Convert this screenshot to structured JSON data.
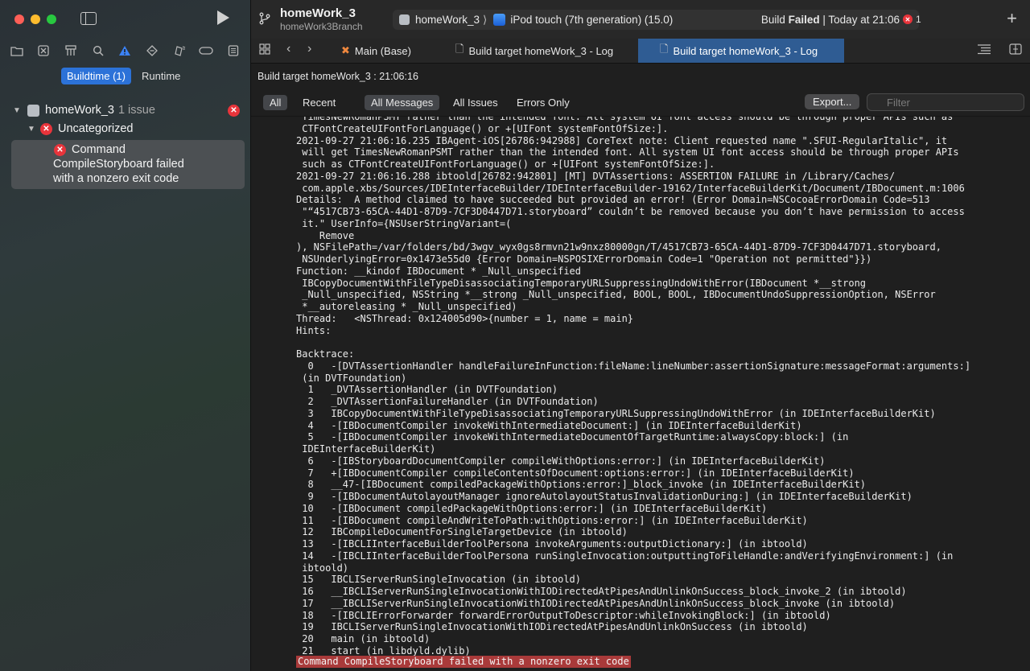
{
  "sidebar": {
    "nav_icons": [
      "folder-icon",
      "source-control-icon",
      "symbol-icon",
      "search-icon",
      "warning-icon",
      "breakpoint-icon",
      "debug-icon",
      "tag-icon",
      "report-icon"
    ],
    "build_tabs": {
      "buildtime": "Buildtime (1)",
      "runtime": "Runtime"
    },
    "project": {
      "name": "homeWork_3",
      "issue_count": "1 issue"
    },
    "group": {
      "label": "Uncategorized"
    },
    "issue": {
      "text_line1": "Command",
      "text_line2": "CompileStoryboard failed",
      "text_line3": "with a nonzero exit code"
    }
  },
  "toolbar": {
    "project_title": "homeWork_3",
    "branch": "homeWork3Branch",
    "scheme": "homeWork_3",
    "destination": "iPod touch (7th generation) (15.0)",
    "status_prefix": "Build ",
    "status_bold": "Failed",
    "status_suffix": " | Today at 21:06",
    "error_count": "1"
  },
  "tabs": [
    {
      "label": "Main (Base)",
      "icon": "swift-file-icon"
    },
    {
      "label": "Build target homeWork_3 - Log",
      "icon": "document-icon"
    },
    {
      "label": "Build target homeWork_3 - Log",
      "icon": "document-icon",
      "active": true
    }
  ],
  "log_header": {
    "title": "Build target homeWork_3 : 21:06:16"
  },
  "filters": {
    "all": "All",
    "recent": "Recent",
    "all_messages": "All Messages",
    "all_issues": "All Issues",
    "errors_only": "Errors Only",
    "export": "Export...",
    "filter_placeholder": "Filter"
  },
  "log_text": " TimesNewRomanPSMT rather than the intended font. All system UI font access should be through proper APIs such as\n CTFontCreateUIFontForLanguage() or +[UIFont systemFontOfSize:].\n2021-09-27 21:06:16.235 IBAgent-iOS[26786:942988] CoreText note: Client requested name \".SFUI-RegularItalic\", it\n will get TimesNewRomanPSMT rather than the intended font. All system UI font access should be through proper APIs\n such as CTFontCreateUIFontForLanguage() or +[UIFont systemFontOfSize:].\n2021-09-27 21:06:16.288 ibtoold[26782:942801] [MT] DVTAssertions: ASSERTION FAILURE in /Library/Caches/\n com.apple.xbs/Sources/IDEInterfaceBuilder/IDEInterfaceBuilder-19162/InterfaceBuilderKit/Document/IBDocument.m:1006\nDetails:  A method claimed to have succeeded but provided an error! (Error Domain=NSCocoaErrorDomain Code=513\n \"“4517CB73-65CA-44D1-87D9-7CF3D0447D71.storyboard” couldn’t be removed because you don’t have permission to access\n it.\" UserInfo={NSUserStringVariant=(\n    Remove\n), NSFilePath=/var/folders/bd/3wgv_wyx0gs8rmvn21w9nxz80000gn/T/4517CB73-65CA-44D1-87D9-7CF3D0447D71.storyboard,\n NSUnderlyingError=0x1473e55d0 {Error Domain=NSPOSIXErrorDomain Code=1 \"Operation not permitted\"}})\nFunction: __kindof IBDocument * _Null_unspecified\n IBCopyDocumentWithFileTypeDisassociatingTemporaryURLSuppressingUndoWithError(IBDocument *__strong\n _Null_unspecified, NSString *__strong _Null_unspecified, BOOL, BOOL, IBDocumentUndoSuppressionOption, NSError\n *__autoreleasing * _Null_unspecified)\nThread:   <NSThread: 0x124005d90>{number = 1, name = main}\nHints:\n\nBacktrace:\n  0   -[DVTAssertionHandler handleFailureInFunction:fileName:lineNumber:assertionSignature:messageFormat:arguments:]\n (in DVTFoundation)\n  1   _DVTAssertionHandler (in DVTFoundation)\n  2   _DVTAssertionFailureHandler (in DVTFoundation)\n  3   IBCopyDocumentWithFileTypeDisassociatingTemporaryURLSuppressingUndoWithError (in IDEInterfaceBuilderKit)\n  4   -[IBDocumentCompiler invokeWithIntermediateDocument:] (in IDEInterfaceBuilderKit)\n  5   -[IBDocumentCompiler invokeWithIntermediateDocumentOfTargetRuntime:alwaysCopy:block:] (in\n IDEInterfaceBuilderKit)\n  6   -[IBStoryboardDocumentCompiler compileWithOptions:error:] (in IDEInterfaceBuilderKit)\n  7   +[IBDocumentCompiler compileContentsOfDocument:options:error:] (in IDEInterfaceBuilderKit)\n  8   __47-[IBDocument compiledPackageWithOptions:error:]_block_invoke (in IDEInterfaceBuilderKit)\n  9   -[IBDocumentAutolayoutManager ignoreAutolayoutStatusInvalidationDuring:] (in IDEInterfaceBuilderKit)\n 10   -[IBDocument compiledPackageWithOptions:error:] (in IDEInterfaceBuilderKit)\n 11   -[IBDocument compileAndWriteToPath:withOptions:error:] (in IDEInterfaceBuilderKit)\n 12   IBCompileDocumentForSingleTargetDevice (in ibtoold)\n 13   -[IBCLIInterfaceBuilderToolPersona invokeArguments:outputDictionary:] (in ibtoold)\n 14   -[IBCLIInterfaceBuilderToolPersona runSingleInvocation:outputtingToFileHandle:andVerifyingEnvironment:] (in\n ibtoold)\n 15   IBCLIServerRunSingleInvocation (in ibtoold)\n 16   __IBCLIServerRunSingleInvocationWithIODirectedAtPipesAndUnlinkOnSuccess_block_invoke_2 (in ibtoold)\n 17   __IBCLIServerRunSingleInvocationWithIODirectedAtPipesAndUnlinkOnSuccess_block_invoke (in ibtoold)\n 18   -[IBCLIErrorForwarder forwardErrorOutputToDescriptor:whileInvokingBlock:] (in ibtoold)\n 19   IBCLIServerRunSingleInvocationWithIODirectedAtPipesAndUnlinkOnSuccess (in ibtoold)\n 20   main (in ibtoold)\n 21   start (in libdyld.dylib)",
  "final_error": "Command CompileStoryboard failed with a nonzero exit code",
  "colors": {
    "accent": "#2c72d8",
    "error": "#e8343b",
    "error_highlight": "#a93a3a"
  }
}
